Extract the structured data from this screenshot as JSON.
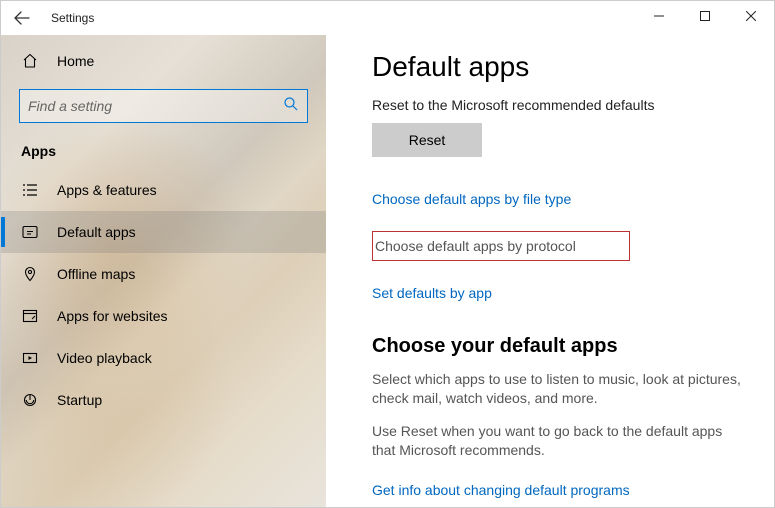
{
  "titlebar": {
    "title": "Settings"
  },
  "sidebar": {
    "home_label": "Home",
    "search_placeholder": "Find a setting",
    "section_title": "Apps",
    "items": [
      {
        "label": "Apps & features"
      },
      {
        "label": "Default apps"
      },
      {
        "label": "Offline maps"
      },
      {
        "label": "Apps for websites"
      },
      {
        "label": "Video playback"
      },
      {
        "label": "Startup"
      }
    ]
  },
  "content": {
    "page_title": "Default apps",
    "reset_caption": "Reset to the Microsoft recommended defaults",
    "reset_button": "Reset",
    "link_file_type": "Choose default apps by file type",
    "link_protocol": "Choose default apps by protocol",
    "link_by_app": "Set defaults by app",
    "choose_heading": "Choose your default apps",
    "choose_para1": "Select which apps to use to listen to music, look at pictures, check mail, watch videos, and more.",
    "choose_para2": "Use Reset when you want to go back to the default apps that Microsoft recommends.",
    "link_info": "Get info about changing default programs"
  }
}
